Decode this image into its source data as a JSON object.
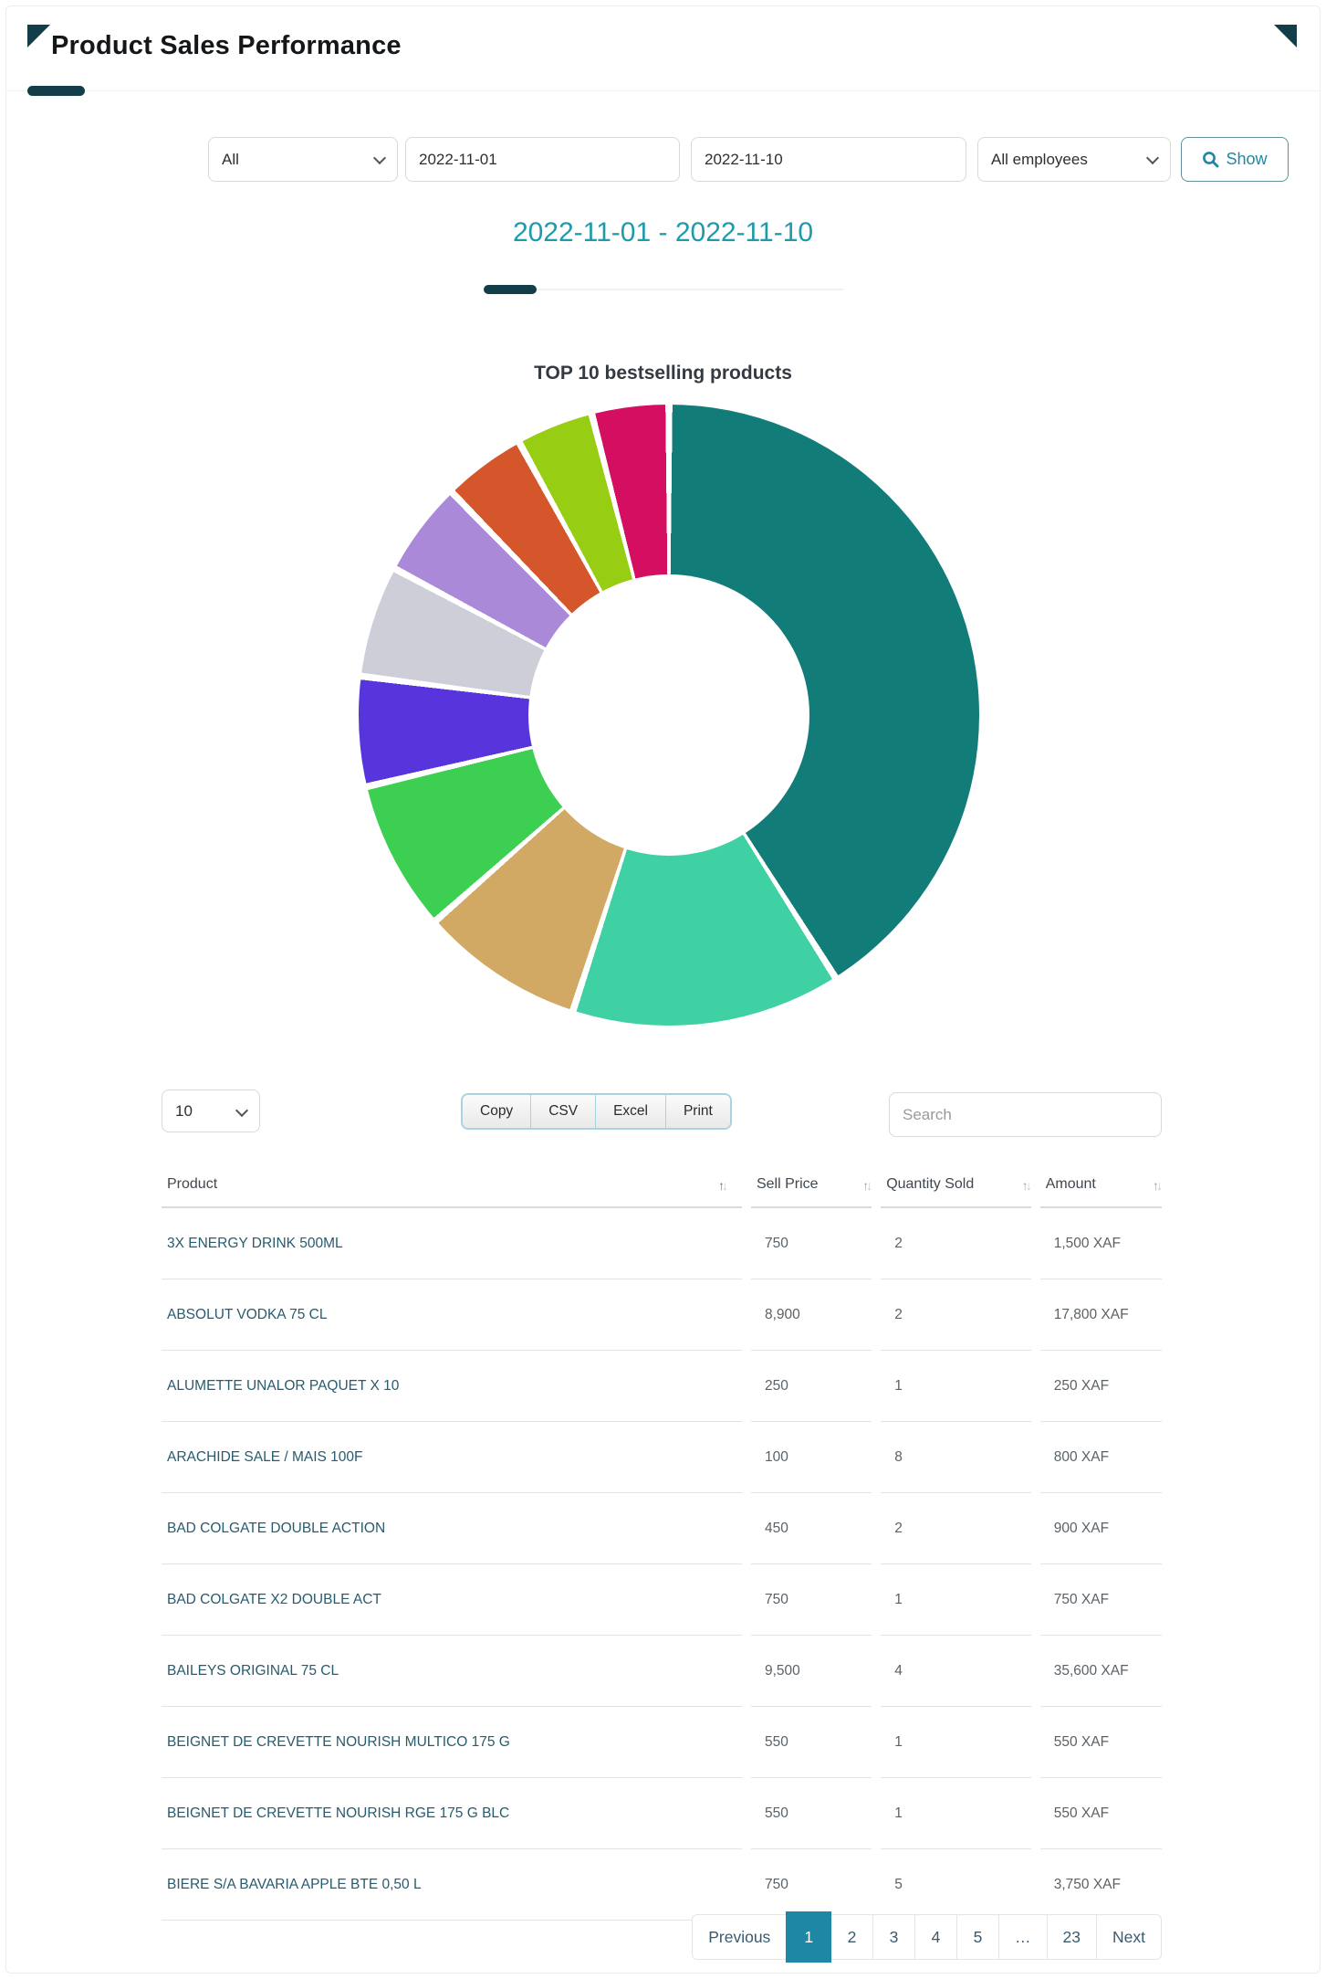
{
  "page": {
    "title": "Product Sales Performance"
  },
  "filters": {
    "category_value": "All",
    "date_from": "2022-11-01",
    "date_to": "2022-11-10",
    "employees_value": "All employees",
    "show_label": "Show"
  },
  "report": {
    "range_title": "2022-11-01 - 2022-11-10"
  },
  "chart_data": {
    "type": "pie",
    "variant": "doughnut",
    "title": "TOP 10 bestselling products",
    "legend": "none",
    "cutout_pct": 45,
    "start": "12 o'clock, clockwise",
    "slices": [
      {
        "color": "#117C78",
        "pct": 41.0
      },
      {
        "color": "#3FD1A4",
        "pct": 14.0
      },
      {
        "color": "#D2A964",
        "pct": 8.5
      },
      {
        "color": "#3CCF51",
        "pct": 7.8
      },
      {
        "color": "#5834DC",
        "pct": 5.7
      },
      {
        "color": "#CDCED8",
        "pct": 5.8
      },
      {
        "color": "#A989D8",
        "pct": 4.9
      },
      {
        "color": "#D4562A",
        "pct": 4.3
      },
      {
        "color": "#97CD13",
        "pct": 4.0
      },
      {
        "color": "#D40F62",
        "pct": 4.0
      }
    ]
  },
  "table_controls": {
    "length_value": "10",
    "export_buttons": [
      "Copy",
      "CSV",
      "Excel",
      "Print"
    ],
    "search_placeholder": "Search"
  },
  "table": {
    "columns": [
      "Product",
      "Sell Price",
      "Quantity Sold",
      "Amount"
    ],
    "sorted_column": "Product",
    "sort_direction": "asc",
    "rows": [
      [
        "3X ENERGY DRINK 500ML",
        "750",
        "2",
        "1,500 XAF"
      ],
      [
        "ABSOLUT VODKA 75 CL",
        "8,900",
        "2",
        "17,800 XAF"
      ],
      [
        "ALUMETTE UNALOR PAQUET X 10",
        "250",
        "1",
        "250 XAF"
      ],
      [
        "ARACHIDE SALE / MAIS 100F",
        "100",
        "8",
        "800 XAF"
      ],
      [
        "BAD COLGATE DOUBLE ACTION",
        "450",
        "2",
        "900 XAF"
      ],
      [
        "BAD COLGATE X2 DOUBLE ACT",
        "750",
        "1",
        "750 XAF"
      ],
      [
        "BAILEYS ORIGINAL 75 CL",
        "9,500",
        "4",
        "35,600 XAF"
      ],
      [
        "BEIGNET DE CREVETTE NOURISH MULTICO 175 G",
        "550",
        "1",
        "550 XAF"
      ],
      [
        "BEIGNET DE CREVETTE NOURISH RGE 175 G BLC",
        "550",
        "1",
        "550 XAF"
      ],
      [
        "BIERE S/A BAVARIA APPLE BTE 0,50 L",
        "750",
        "5",
        "3,750 XAF"
      ]
    ]
  },
  "pagination": {
    "previous_label": "Previous",
    "next_label": "Next",
    "pages": [
      "1",
      "2",
      "3",
      "4",
      "5",
      "…",
      "23"
    ],
    "active_page": "1"
  },
  "colors": {
    "accent_dark": "#143D4A",
    "heading_teal": "#1F9AAB",
    "action_teal": "#1D87A5",
    "product_text": "#275B6E"
  }
}
